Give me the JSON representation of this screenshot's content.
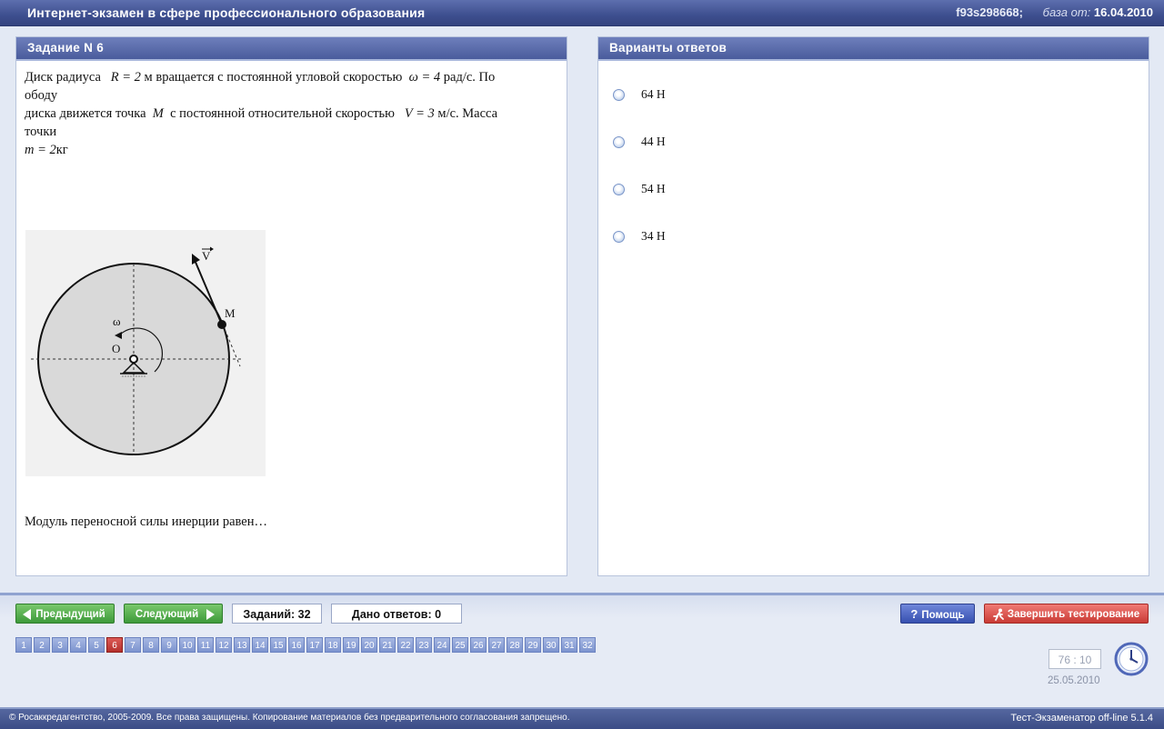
{
  "window": {
    "title": "Интернет-экзамен в сфере профессионального образования",
    "session_code": "f93s298668;",
    "base_label": "база от:",
    "base_date": "16.04.2010"
  },
  "task": {
    "header": "Задание N 6",
    "text_line1_a": "Диск радиуса",
    "text_line1_b": "м вращается с постоянной угловой скоростью",
    "text_line1_c": "рад/с. По",
    "text_line2": "ободу",
    "text_line3_a": "диска движется точка",
    "text_line3_b": "с постоянной относительной скоростью",
    "text_line3_c": "м/с. Масса",
    "text_line4": "точки",
    "formula_R": "R = 2",
    "formula_omega": "ω = 4",
    "symbol_M": "M",
    "formula_V": "V = 3",
    "formula_m": "m = 2",
    "mass_unit": "кг",
    "figure_labels": {
      "V": "V",
      "M": "M",
      "omega": "ω",
      "O": "O"
    },
    "question": "Модуль переносной силы инерции равен…"
  },
  "answers": {
    "header": "Варианты ответов",
    "options": [
      "64 Н",
      "44 Н",
      "54 Н",
      "34 Н"
    ]
  },
  "controls": {
    "prev_label": "Предыдущий",
    "next_label": "Следующий",
    "tasks_count": "Заданий: 32",
    "answered_count": "Дано ответов: 0",
    "help_label": "Помощь",
    "finish_label": "Завершить тестирование"
  },
  "navigator": {
    "numbers": [
      "1",
      "2",
      "3",
      "4",
      "5",
      "6",
      "7",
      "8",
      "9",
      "10",
      "11",
      "12",
      "13",
      "14",
      "15",
      "16",
      "17",
      "18",
      "19",
      "20",
      "21",
      "22",
      "23",
      "24",
      "25",
      "26",
      "27",
      "28",
      "29",
      "30",
      "31",
      "32"
    ],
    "active": "6"
  },
  "timer": {
    "value": "76 : 10",
    "date": "25.05.2010"
  },
  "footer": {
    "copyright": "© Росаккредагентство, 2005-2009. Все права защищены. Копирование материалов без предварительного согласования запрещено.",
    "version": "Тест-Экзаменатор off-line 5.1.4"
  },
  "colors": {
    "accent": "#4a5c9c",
    "active_question": "#c4403b",
    "green_button": "#4fa948",
    "red_button": "#d24842"
  }
}
